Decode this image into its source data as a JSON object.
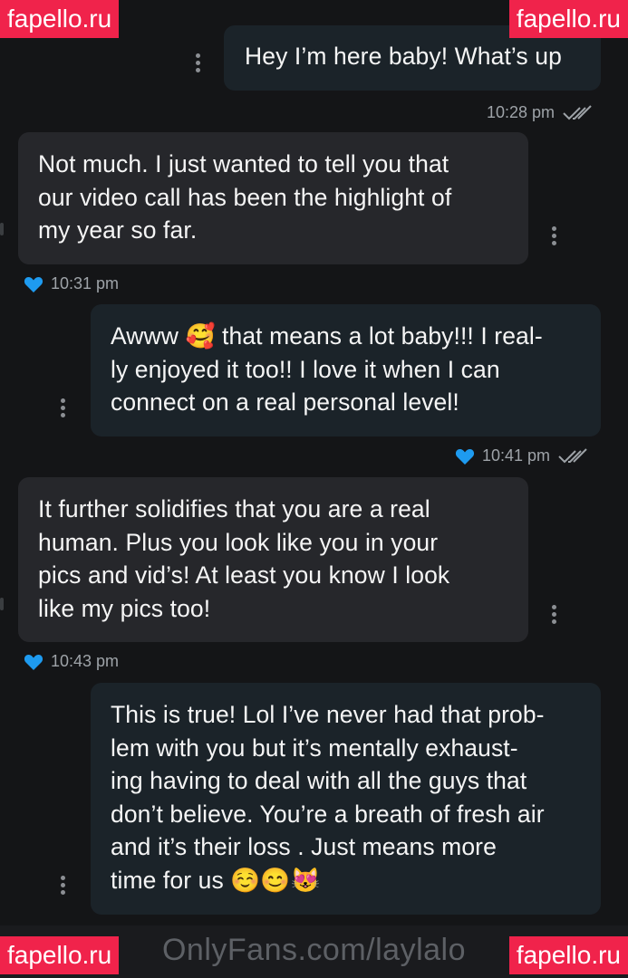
{
  "watermark": "fapello.ru",
  "footer_text": "OnlyFans.com/laylalo",
  "messages": [
    {
      "direction": "outgoing",
      "lines": [
        "Hey I’m here baby! What’s up"
      ],
      "time": "10:28 pm",
      "liked": false,
      "read": true
    },
    {
      "direction": "incoming",
      "lines": [
        "Not much. I just wanted to tell you that",
        "our video call has been the highlight of",
        "my year so far."
      ],
      "time": "10:31 pm",
      "liked": true
    },
    {
      "direction": "outgoing",
      "lines": [
        "Awww 🥰 that means a lot baby!!! I real-",
        "ly enjoyed it too!! I love it when I can",
        "connect on a real personal level!"
      ],
      "time": "10:41 pm",
      "liked": true,
      "read": true
    },
    {
      "direction": "incoming",
      "lines": [
        "It further solidifies that you are a real",
        "human. Plus you look like you in your",
        "pics and vid’s! At least you know I look",
        "like my pics too!"
      ],
      "time": "10:43 pm",
      "liked": true
    },
    {
      "direction": "outgoing",
      "lines": [
        "This is true! Lol I’ve never had that prob-",
        "lem with you but it’s mentally exhaust-",
        "ing having to deal with all the guys that",
        "don’t believe. You’re a breath of fresh air",
        "and it’s their loss . Just means more",
        "time for us ☺️😊😻"
      ]
    }
  ],
  "colors": {
    "background": "#141517",
    "outgoing_bubble": "#1b2329",
    "incoming_bubble": "#26272b",
    "heart": "#1e9bf0",
    "watermark_bg": "#f0234b"
  },
  "icons": [
    "more-vertical-icon",
    "heart-icon",
    "double-check-icon"
  ]
}
